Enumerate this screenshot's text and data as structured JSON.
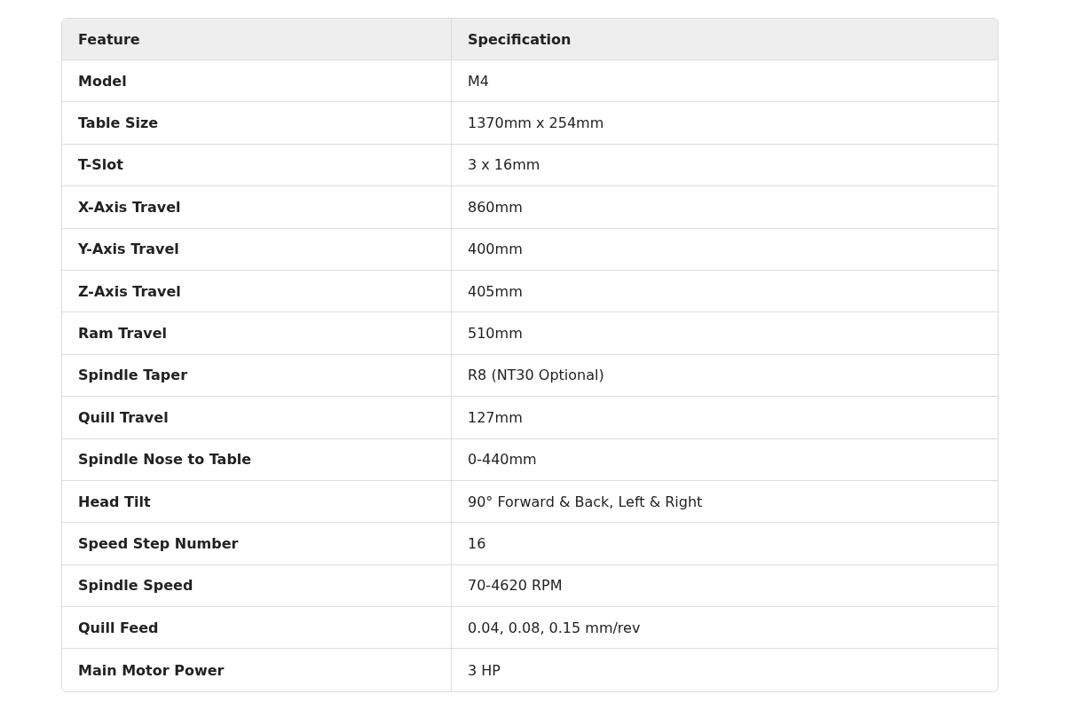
{
  "table": {
    "columns": [
      "Feature",
      "Specification"
    ],
    "rows": [
      {
        "feature": "Model",
        "specification": "M4"
      },
      {
        "feature": "Table Size",
        "specification": "1370mm x 254mm"
      },
      {
        "feature": "T-Slot",
        "specification": "3 x 16mm"
      },
      {
        "feature": "X-Axis Travel",
        "specification": "860mm"
      },
      {
        "feature": "Y-Axis Travel",
        "specification": "400mm"
      },
      {
        "feature": "Z-Axis Travel",
        "specification": "405mm"
      },
      {
        "feature": "Ram Travel",
        "specification": "510mm"
      },
      {
        "feature": "Spindle Taper",
        "specification": "R8 (NT30 Optional)"
      },
      {
        "feature": "Quill Travel",
        "specification": "127mm"
      },
      {
        "feature": "Spindle Nose to Table",
        "specification": "0-440mm"
      },
      {
        "feature": "Head Tilt",
        "specification": "90° Forward & Back, Left & Right"
      },
      {
        "feature": "Speed Step Number",
        "specification": "16"
      },
      {
        "feature": "Spindle Speed",
        "specification": "70-4620 RPM"
      },
      {
        "feature": "Quill Feed",
        "specification": "0.04, 0.08, 0.15 mm/rev"
      },
      {
        "feature": "Main Motor Power",
        "specification": "3 HP"
      }
    ]
  }
}
